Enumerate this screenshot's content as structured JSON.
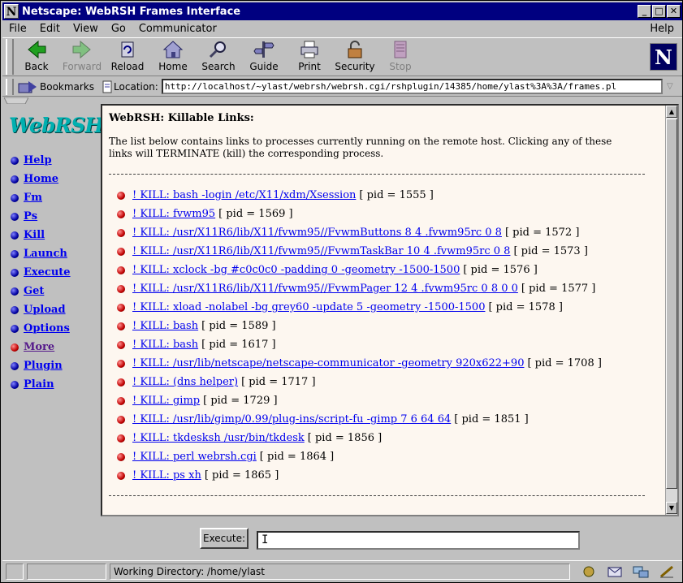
{
  "window": {
    "title": "Netscape: WebRSH Frames Interface",
    "logo_letter": "N",
    "buttons": [
      "_",
      "□",
      "✕"
    ]
  },
  "menu": {
    "items": [
      "File",
      "Edit",
      "View",
      "Go",
      "Communicator"
    ],
    "help": "Help"
  },
  "toolbar": {
    "buttons": [
      {
        "label": "Back",
        "icon": "back-arrow-icon",
        "enabled": true
      },
      {
        "label": "Forward",
        "icon": "forward-arrow-icon",
        "enabled": false
      },
      {
        "label": "Reload",
        "icon": "reload-icon",
        "enabled": true
      },
      {
        "label": "Home",
        "icon": "home-icon",
        "enabled": true
      },
      {
        "label": "Search",
        "icon": "search-icon",
        "enabled": true
      },
      {
        "label": "Guide",
        "icon": "guide-icon",
        "enabled": true
      },
      {
        "label": "Print",
        "icon": "print-icon",
        "enabled": true
      },
      {
        "label": "Security",
        "icon": "security-lock-icon",
        "enabled": true
      },
      {
        "label": "Stop",
        "icon": "stop-icon",
        "enabled": false
      }
    ]
  },
  "location": {
    "bookmarks_label": "Bookmarks",
    "location_label": "Location:",
    "url": "http://localhost/~ylast/webrsh/webrsh.cgi/rshplugin/14385/home/ylast%3A%3A/frames.pl"
  },
  "sidebar": {
    "logo": "WebRSH",
    "items": [
      {
        "label": "Help",
        "active": false
      },
      {
        "label": "Home",
        "active": false
      },
      {
        "label": "Fm",
        "active": false
      },
      {
        "label": "Ps",
        "active": false
      },
      {
        "label": "Kill",
        "active": false
      },
      {
        "label": "Launch",
        "active": false
      },
      {
        "label": "Execute",
        "active": false
      },
      {
        "label": "Get",
        "active": false
      },
      {
        "label": "Upload",
        "active": false
      },
      {
        "label": "Options",
        "active": false
      },
      {
        "label": "More",
        "active": true
      },
      {
        "label": "Plugin",
        "active": false
      },
      {
        "label": "Plain",
        "active": false
      }
    ]
  },
  "main": {
    "heading": "WebRSH: Killable Links:",
    "intro": "The list below contains links to processes currently running on the remote host. Clicking any of these links will TERMINATE (kill) the corresponding process.",
    "processes": [
      {
        "link": "! KILL: bash -login /etc/X11/xdm/Xsession ",
        "pid": "[ pid = 1555 ]"
      },
      {
        "link": "! KILL: fvwm95 ",
        "pid": "[ pid = 1569 ]"
      },
      {
        "link": "! KILL: /usr/X11R6/lib/X11/fvwm95//FvwmButtons 8 4 .fvwm95rc 0 8 ",
        "pid": "[ pid = 1572 ]"
      },
      {
        "link": "! KILL: /usr/X11R6/lib/X11/fvwm95//FvwmTaskBar 10 4 .fvwm95rc 0 8 ",
        "pid": "[ pid = 1573 ]"
      },
      {
        "link": "! KILL: xclock -bg #c0c0c0 -padding 0 -geometry -1500-1500 ",
        "pid": "[ pid = 1576 ]"
      },
      {
        "link": "! KILL: /usr/X11R6/lib/X11/fvwm95//FvwmPager 12 4 .fvwm95rc 0 8 0 0 ",
        "pid": "[ pid = 1577 ]"
      },
      {
        "link": "! KILL: xload -nolabel -bg grey60 -update 5 -geometry -1500-1500 ",
        "pid": "[ pid = 1578 ]"
      },
      {
        "link": "! KILL: bash ",
        "pid": "[ pid = 1589 ]"
      },
      {
        "link": "! KILL: bash ",
        "pid": "[ pid = 1617 ]"
      },
      {
        "link": "! KILL: /usr/lib/netscape/netscape-communicator -geometry 920x622+90 ",
        "pid": "[ pid = 1708 ]"
      },
      {
        "link": "! KILL: (dns helper) ",
        "pid": "[ pid = 1717 ]"
      },
      {
        "link": "! KILL: gimp ",
        "pid": "[ pid = 1729 ]"
      },
      {
        "link": "! KILL: /usr/lib/gimp/0.99/plug-ins/script-fu -gimp 7 6 64 64 ",
        "pid": "[ pid = 1851 ]"
      },
      {
        "link": "! KILL: tkdesksh /usr/bin/tkdesk ",
        "pid": "[ pid = 1856 ]"
      },
      {
        "link": "! KILL: perl webrsh.cgi ",
        "pid": "[ pid = 1864 ]"
      },
      {
        "link": "! KILL: ps xh ",
        "pid": "[ pid = 1865 ]"
      }
    ]
  },
  "execute": {
    "button_label": "Execute:",
    "input_value": "",
    "caret": "I"
  },
  "status": {
    "text": "Working Directory: /home/ylast"
  },
  "colors": {
    "link": "#0000ee",
    "title_bg": "#000080",
    "page_bg": "#fdf7f0",
    "chrome": "#c0c0c0"
  }
}
